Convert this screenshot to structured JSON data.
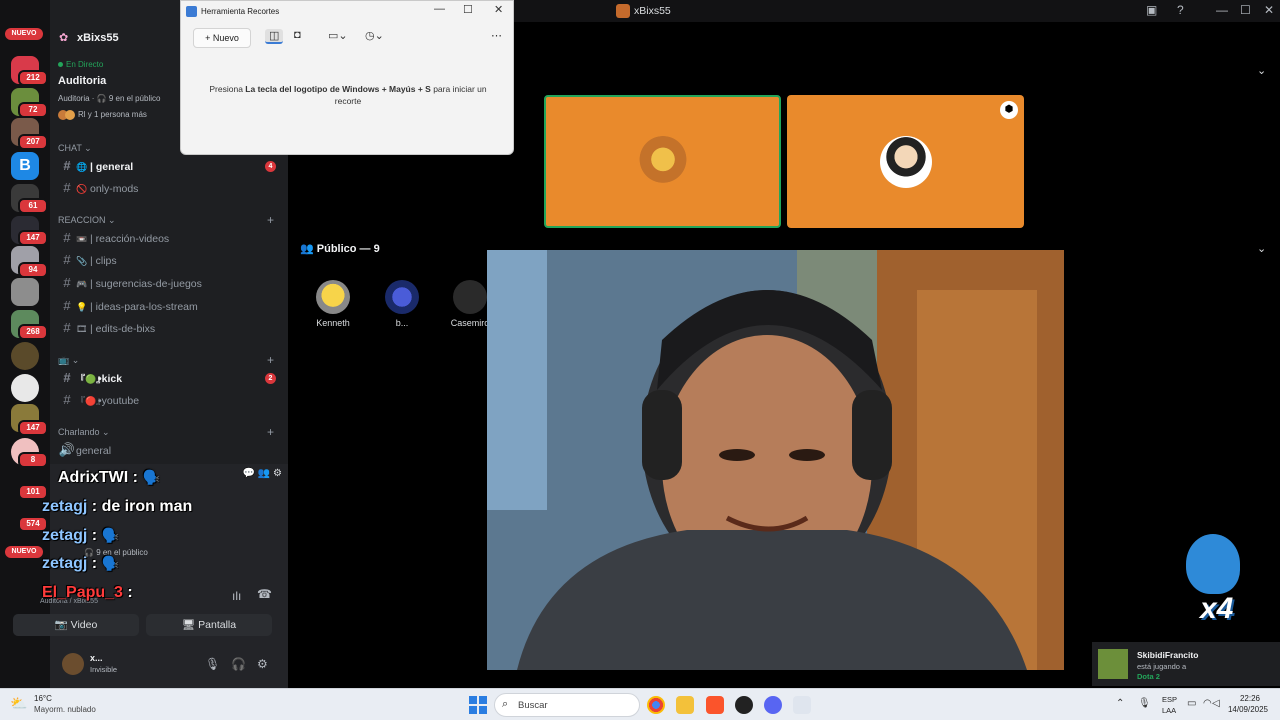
{
  "window": {
    "title": "xBixs55"
  },
  "server_rail": {
    "nuevo_top": "NUEVO",
    "nuevo_bottom": "NUEVO",
    "badges": [
      "212",
      "72",
      "207",
      "61",
      "147",
      "94",
      "268",
      "147",
      "8",
      "101",
      "574"
    ]
  },
  "server": {
    "name": "xBixs55",
    "live_label": "En Directo",
    "stage_title": "Auditoria",
    "stage_meta": "Auditoria · 🎧 9 en el público",
    "stage_people": "Rl y 1 persona más"
  },
  "categories": {
    "chat": "CHAT",
    "reaccion": "REACCION",
    "charlando": "Charlando"
  },
  "channels": {
    "general": "| general",
    "general_badge": "4",
    "only_mods": "only-mods",
    "reaccion_videos": "| reacción-videos",
    "clips": "| clips",
    "sugerencias": "| sugerencias-de-juegos",
    "ideas": "| ideas-para-los-stream",
    "edits": "| edits-de-bixs",
    "kick": "•kick",
    "kick_badge": "2",
    "youtube": "•youtube",
    "voice_general": "general"
  },
  "chat_overlay": [
    {
      "nick": "AdrixTWI",
      "sep": " : ",
      "text": "🗣️"
    },
    {
      "nick": "zetagj",
      "sep": " : ",
      "text": "de iron man"
    },
    {
      "nick": "zetagj",
      "sep": " : ",
      "text": "🗣️"
    },
    {
      "nick": "zetagj",
      "sep": " : ",
      "text": "🗣️"
    },
    {
      "nick": "El_Papu_3",
      "sep": " : ",
      "text": ""
    }
  ],
  "voice": {
    "status": "9 en el público",
    "sub": "Auditoria / xBixs55",
    "video_btn": "Video",
    "screen_btn": "Pantalla"
  },
  "user": {
    "name": "x...",
    "status": "Invisible"
  },
  "stage": {
    "audience_header": "Público — 9",
    "audience": [
      "Kenneth",
      "b...",
      "Casemiro"
    ]
  },
  "snipping_tool": {
    "title": "Herramienta Recortes",
    "new_button": "Nuevo",
    "msg_pre": "Presiona ",
    "msg_bold": "La tecla del logotipo de Windows + Mayús + S",
    "msg_post": " para iniciar un recorte"
  },
  "notification": {
    "user": "SkibidiFrancito",
    "activity": "está jugando a",
    "game": "Dota 2"
  },
  "overlay_emote": {
    "multiplier": "x4"
  },
  "taskbar": {
    "temp": "16°C",
    "weather": "Mayorm. nublado",
    "search": "Buscar",
    "lang1": "ESP",
    "lang2": "LAA",
    "time": "22:26",
    "date": "14/09/2025"
  },
  "colors": {
    "tile_orange": "#e98a2c",
    "speaking_green": "#23a55a",
    "badge_red": "#da373c"
  }
}
